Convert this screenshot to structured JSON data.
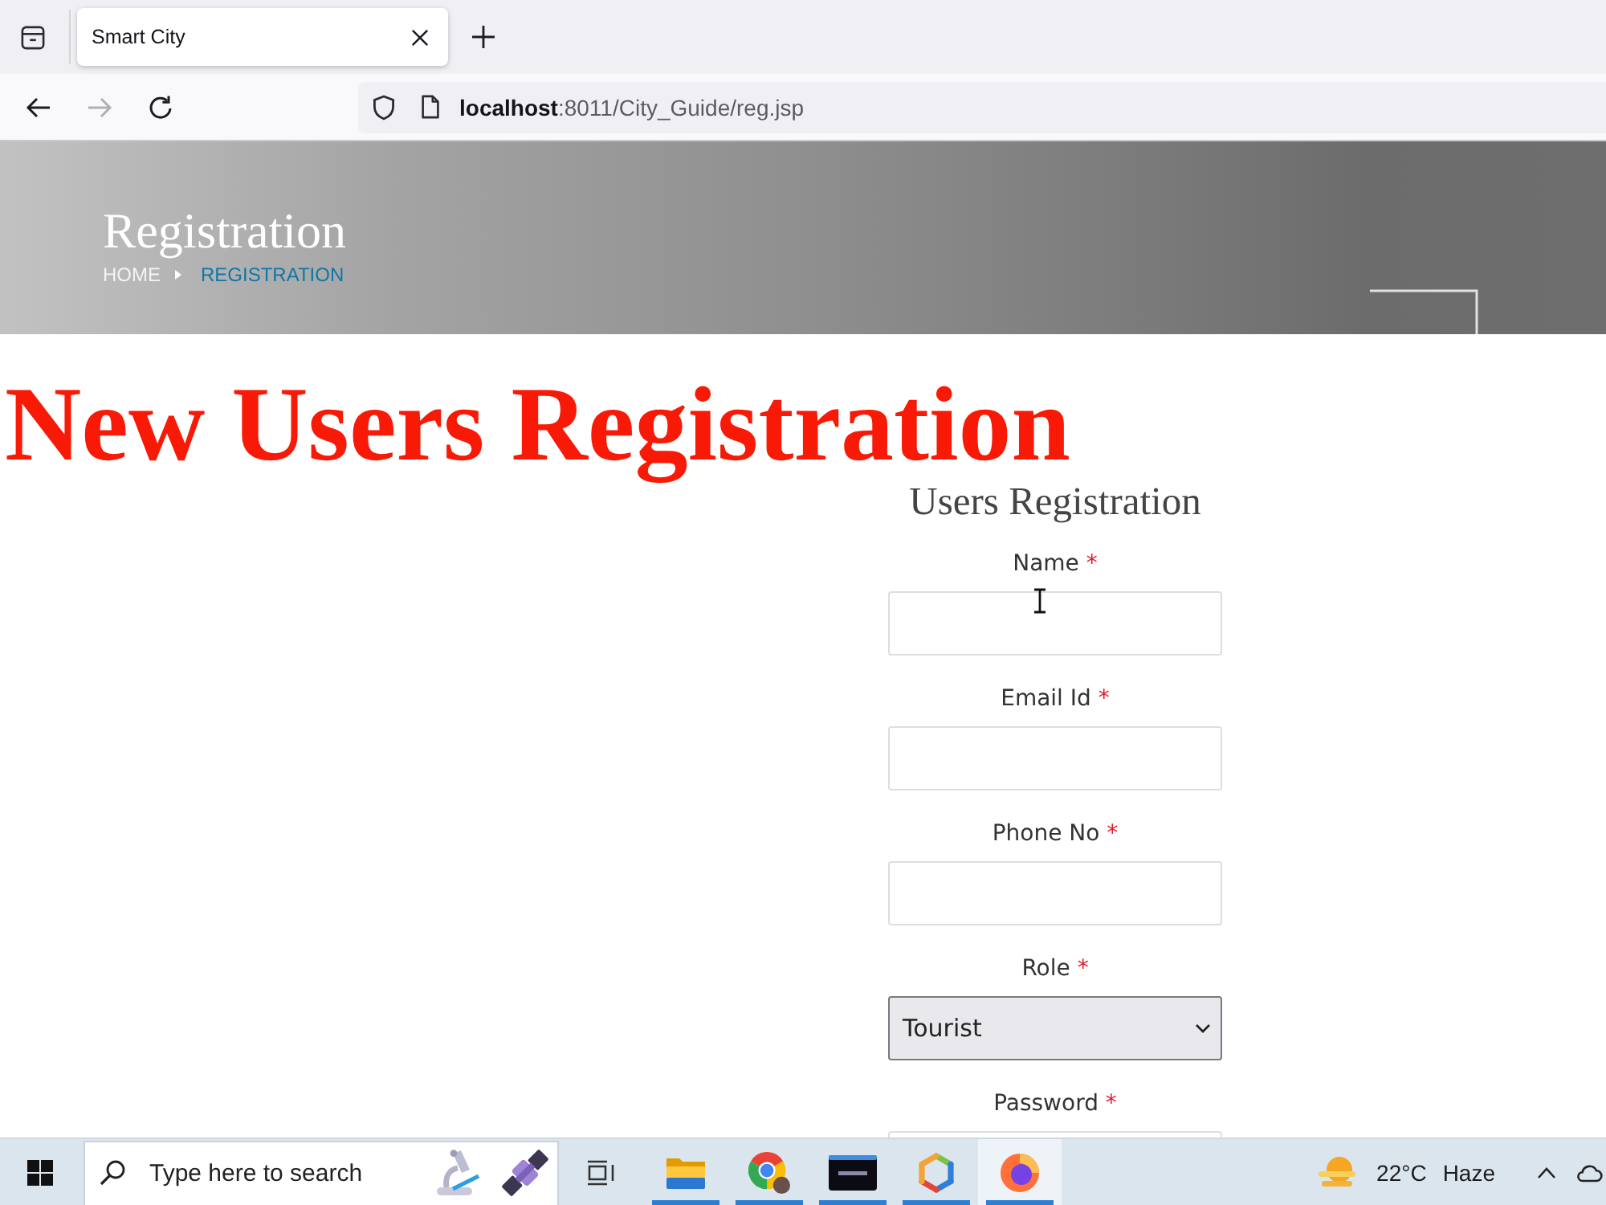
{
  "browser": {
    "tabs": [
      {
        "title": "Smart City",
        "selected": true
      }
    ],
    "nav_buttons": [
      {
        "kind": "back",
        "disabled": false
      },
      {
        "kind": "forward",
        "disabled": true
      },
      {
        "kind": "reload",
        "disabled": false
      }
    ],
    "address": {
      "host": "localhost",
      "path": ":8011/City_Guide/reg.jsp"
    }
  },
  "banner": {
    "title": "Registration",
    "breadcrumb": [
      {
        "label": "HOME",
        "selected": false
      },
      {
        "label": "REGISTRATION",
        "selected": true
      }
    ]
  },
  "heading": "New Users Registration",
  "form": {
    "title": "Users Registration",
    "fields": [
      {
        "kind": "text",
        "label": "Name",
        "required_mark": "*",
        "hovered": true
      },
      {
        "kind": "text",
        "label": "Email Id",
        "required_mark": "*",
        "hovered": false
      },
      {
        "kind": "text",
        "label": "Phone No",
        "required_mark": "*",
        "hovered": false
      },
      {
        "kind": "select",
        "label": "Role",
        "required_mark": "*",
        "value": "Tourist",
        "hovered": false
      },
      {
        "kind": "password",
        "label": "Password",
        "required_mark": "*",
        "hovered": false
      }
    ]
  },
  "taskbar": {
    "search": {
      "placeholder": "Type here to search"
    },
    "apps": [
      {
        "kind": "folder",
        "running": true,
        "selected": false
      },
      {
        "kind": "chrome",
        "running": true,
        "selected": false
      },
      {
        "kind": "terminal",
        "running": true,
        "selected": false
      },
      {
        "kind": "hexagon",
        "running": true,
        "selected": false
      },
      {
        "kind": "firefox",
        "running": true,
        "selected": true
      }
    ],
    "weather": {
      "temperature": "22°C",
      "condition": "Haze"
    }
  }
}
